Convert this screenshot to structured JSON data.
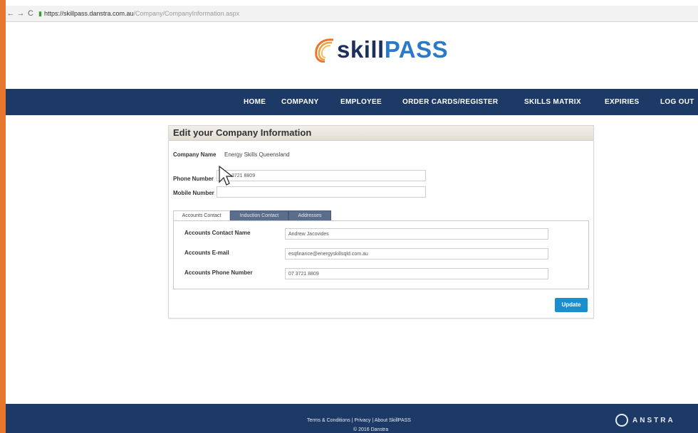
{
  "browser": {
    "back": "←",
    "forward": "→",
    "reload": "C",
    "url_host": "https://skillpass.danstra.com.au",
    "url_path": "/Company/CompanyInformation.aspx"
  },
  "logo": {
    "part1": "skill",
    "part2": "PASS"
  },
  "nav": {
    "items": [
      "HOME",
      "COMPANY",
      "EMPLOYEE",
      "ORDER CARDS/REGISTER",
      "SKILLS MATRIX",
      "EXPIRIES",
      "LOG OUT"
    ]
  },
  "panel": {
    "title": "Edit your Company Information",
    "company_name_label": "Company Name",
    "company_name_value": "Energy Skills Queensland",
    "phone_label": "Phone Number",
    "phone_value": "3721 8809",
    "mobile_label": "Mobile Number",
    "mobile_value": "",
    "tabs": [
      "Accounts Contact",
      "Induction Contact",
      "Addresses"
    ],
    "accounts": {
      "name_label": "Accounts Contact Name",
      "name_value": "Andrew Jacovides",
      "email_label": "Accounts E-mail",
      "email_value": "esqfinance@energyskillsqld.com.au",
      "phone_label": "Accounts Phone Number",
      "phone_value": "07 3721 8809"
    },
    "update_label": "Update"
  },
  "footer": {
    "terms": "Terms & Conditions",
    "sep1": "|",
    "privacy": "Privacy",
    "sep2": "|",
    "about": "About SkillPASS",
    "copyright": "© 2016 Danstra",
    "brand": "ANSTRA"
  },
  "colors": {
    "nav_bg": "#1d3a66",
    "accent_blue": "#1a8fd0",
    "logo_orange": "#e8772e"
  }
}
